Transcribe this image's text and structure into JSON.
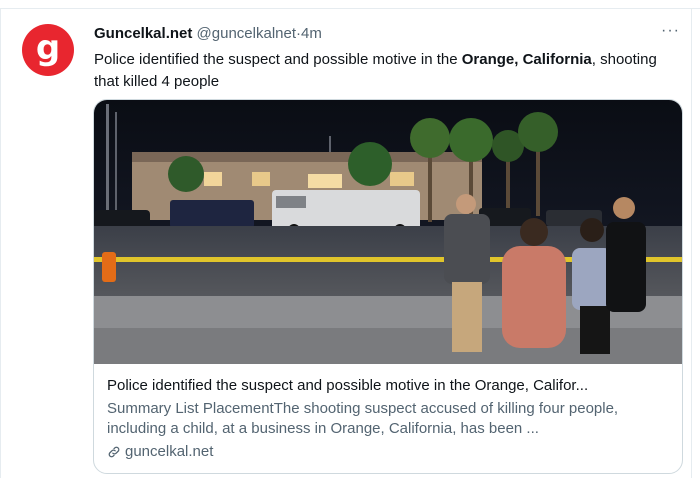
{
  "account": {
    "avatar_letter": "g",
    "name": "Guncelkal.net",
    "handle": "@guncelkalnet",
    "separator": "·",
    "time": "4m"
  },
  "more_label": "···",
  "tweet": {
    "text_before": "Police identified the suspect and possible motive in the ",
    "text_bold": "Orange, California",
    "text_after": ", shooting that killed 4 people"
  },
  "card": {
    "title": "Police identified the suspect and possible motive in the Orange, Califor...",
    "description": "Summary List PlacementThe shooting suspect accused of killing four people, including a child, at a business in Orange, California, has been ...",
    "domain": "guncelkal.net"
  },
  "colors": {
    "avatar_bg": "#e8262f",
    "secondary_text": "#536471",
    "border": "#cfd9de"
  },
  "icons": {
    "more": "more-horizontal-icon",
    "link": "link-icon"
  }
}
